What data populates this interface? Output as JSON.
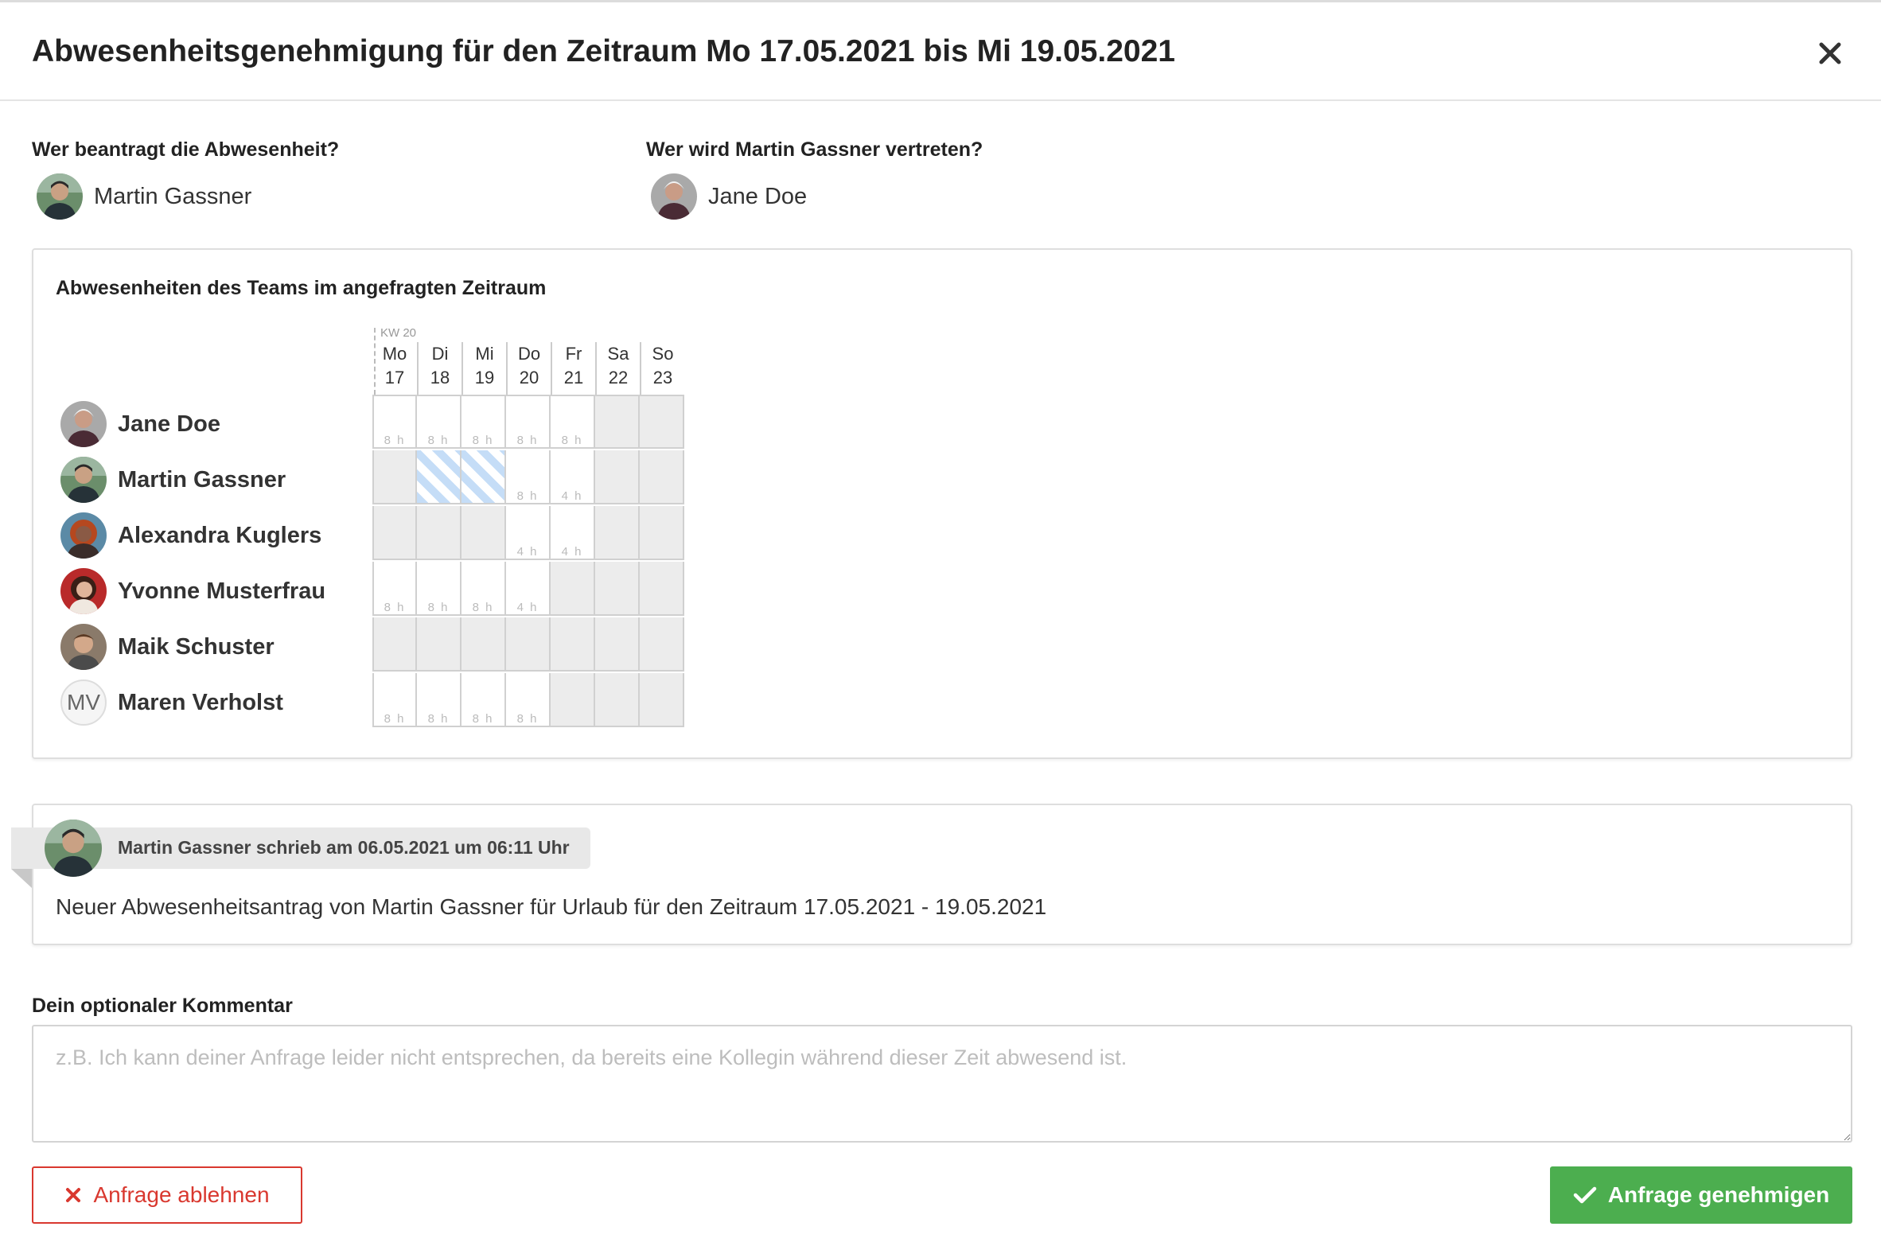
{
  "dialog": {
    "title": "Abwesenheitsgenehmigung für den Zeitraum Mo 17.05.2021 bis Mi 19.05.2021",
    "close_icon": "close-icon"
  },
  "requester": {
    "label": "Wer beantragt die Abwesenheit?",
    "name": "Martin Gassner"
  },
  "substitute": {
    "label": "Wer wird Martin Gassner vertreten?",
    "name": "Jane Doe"
  },
  "team": {
    "title": "Abwesenheiten des Teams im angefragten Zeitraum",
    "week": "KW 20",
    "days": [
      {
        "dow": "Mo",
        "date": "17"
      },
      {
        "dow": "Di",
        "date": "18"
      },
      {
        "dow": "Mi",
        "date": "19"
      },
      {
        "dow": "Do",
        "date": "20"
      },
      {
        "dow": "Fr",
        "date": "21"
      },
      {
        "dow": "Sa",
        "date": "22"
      },
      {
        "dow": "So",
        "date": "23"
      }
    ],
    "members": [
      {
        "name": "Jane Doe",
        "cells": [
          "8 h",
          "8 h",
          "8 h",
          "8 h",
          "8 h",
          "off",
          "off"
        ]
      },
      {
        "name": "Martin Gassner",
        "cells": [
          "off",
          "absent",
          "absent",
          "8 h",
          "4 h",
          "off",
          "off"
        ]
      },
      {
        "name": "Alexandra Kuglers",
        "cells": [
          "off",
          "off",
          "off",
          "4 h",
          "4 h",
          "off",
          "off"
        ]
      },
      {
        "name": "Yvonne Musterfrau",
        "cells": [
          "8 h",
          "8 h",
          "8 h",
          "4 h",
          "off",
          "off",
          "off"
        ]
      },
      {
        "name": "Maik Schuster",
        "cells": [
          "off",
          "off",
          "off",
          "off",
          "off",
          "off",
          "off"
        ]
      },
      {
        "name": "Maren Verholst",
        "initials": "MV",
        "cells": [
          "8 h",
          "8 h",
          "8 h",
          "8 h",
          "off",
          "off",
          "off"
        ]
      }
    ],
    "colors": {
      "off": "#ececec",
      "absent_hatch": "#c5ddf7"
    }
  },
  "message": {
    "author_line": "Martin Gassner schrieb am 06.05.2021 um 06:11 Uhr",
    "text": "Neuer Abwesenheitsantrag von Martin Gassner für Urlaub für den Zeitraum 17.05.2021 - 19.05.2021"
  },
  "comment": {
    "label": "Dein optionaler Kommentar",
    "placeholder": "z.B. Ich kann deiner Anfrage leider nicht entsprechen, da bereits eine Kollegin während dieser Zeit abwesend ist.",
    "value": ""
  },
  "actions": {
    "reject_label": "Anfrage ablehnen",
    "reject_icon": "x-icon",
    "approve_label": "Anfrage genehmigen",
    "approve_icon": "check-icon",
    "colors": {
      "reject": "#d9382f",
      "approve": "#4cae4f"
    }
  }
}
